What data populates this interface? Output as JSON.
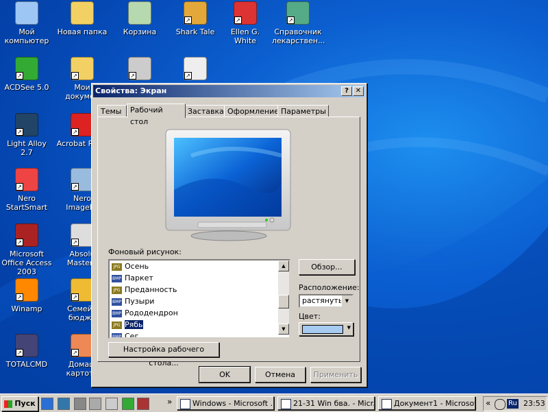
{
  "colors": {
    "accent": "#0a246a",
    "desktop": "#0548b4",
    "list_selected": "#0a246a",
    "color_swatch": "#a6caf0"
  },
  "desktop_icons": [
    {
      "label": "Мой компьютер",
      "icon": "computer-icon"
    },
    {
      "label": "Новая папка",
      "icon": "folder-icon"
    },
    {
      "label": "Корзина",
      "icon": "recycle-bin-icon"
    },
    {
      "label": "Shark Tale",
      "icon": "shark-tale-icon"
    },
    {
      "label": "Ellen G. White",
      "icon": "ellen-g-white-icon"
    },
    {
      "label": "Справочник лекарствен...",
      "icon": "syringe-icon"
    },
    {
      "label": "ACDSee 5.0",
      "icon": "acdsee-icon"
    },
    {
      "label": "Мои докумен",
      "icon": "my-documents-icon"
    },
    {
      "label": "",
      "icon": "plug-icon"
    },
    {
      "label": "",
      "icon": "window-icon"
    },
    {
      "label": "Light Alloy 2.7",
      "icon": "light-alloy-icon"
    },
    {
      "label": "Acrobat R 5.0",
      "icon": "acrobat-icon"
    },
    {
      "label": "Nero StartSmart",
      "icon": "nero-icon"
    },
    {
      "label": "Nero ImageDr",
      "icon": "nero-imagedrive-icon"
    },
    {
      "label": "Microsoft Office Access 2003",
      "icon": "access-icon"
    },
    {
      "label": "Absolu Mastern",
      "icon": "absolute-icon"
    },
    {
      "label": "Winamp",
      "icon": "winamp-icon"
    },
    {
      "label": "Семейн бюдже",
      "icon": "family-budget-icon"
    },
    {
      "label": "TOTALCMD",
      "icon": "floppy-icon"
    },
    {
      "label": "Домаш картоте",
      "icon": "home-card-icon"
    }
  ],
  "dialog": {
    "title": "Свойства: Экран",
    "help_label": "?",
    "close_label": "✕",
    "tabs": [
      {
        "label": "Темы"
      },
      {
        "label": "Рабочий стол"
      },
      {
        "label": "Заставка"
      },
      {
        "label": "Оформление"
      },
      {
        "label": "Параметры"
      }
    ],
    "background_label": "Фоновый рисунок:",
    "wallpapers": [
      {
        "name": "Осень",
        "type": "JPG"
      },
      {
        "name": "Паркет",
        "type": "BMP"
      },
      {
        "name": "Преданность",
        "type": "JPG"
      },
      {
        "name": "Пузыри",
        "type": "BMP"
      },
      {
        "name": "Рододендрон",
        "type": "BMP"
      },
      {
        "name": "Рябь",
        "type": "JPG",
        "selected": true
      },
      {
        "name": "Сег",
        "type": "BMP"
      }
    ],
    "browse_label": "Обзор...",
    "position_label": "Расположение:",
    "position_value": "растянуть",
    "color_label": "Цвет:",
    "customize_label": "Настройка рабочего стола...",
    "ok_label": "OK",
    "cancel_label": "Отмена",
    "apply_label": "Применить"
  },
  "taskbar": {
    "start_label": "Пуск",
    "quick_launch": [
      "ie-icon",
      "msn-icon",
      "network-icon",
      "disk-icon",
      "media-icon",
      "mac-icon",
      "floppy-icon"
    ],
    "chevron": "»",
    "tasks": [
      {
        "label": "Windows - Microsoft ...",
        "icon": "word-doc-icon"
      },
      {
        "label": "21-31  Win бва. - Micr...",
        "icon": "word-doc-icon"
      },
      {
        "label": "Документ1 - Microsof...",
        "icon": "word-doc-icon"
      }
    ],
    "tray_chevron": "«",
    "lang": "Ru",
    "clock": "23:53"
  }
}
